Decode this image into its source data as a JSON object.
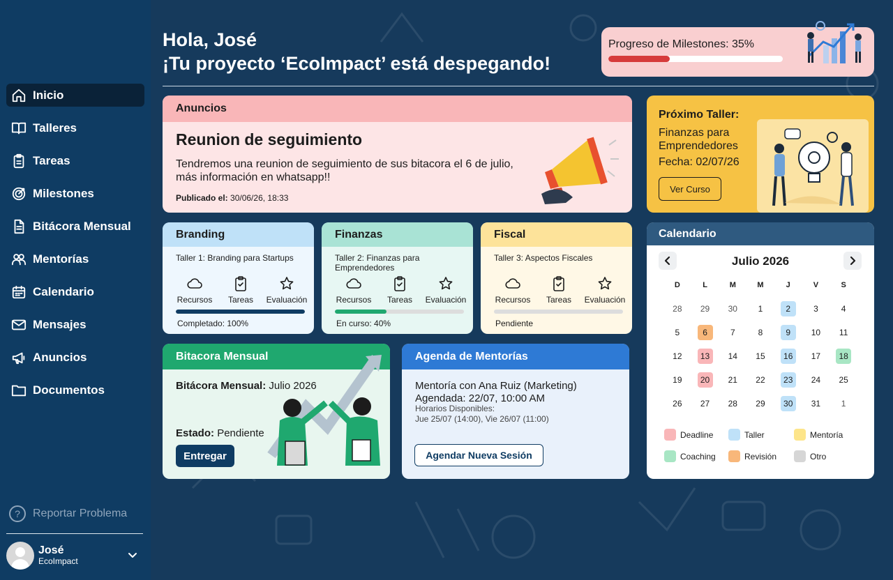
{
  "sidebar": {
    "items": [
      {
        "label": "Inicio",
        "icon": "home-icon"
      },
      {
        "label": "Talleres",
        "icon": "book-icon"
      },
      {
        "label": "Tareas",
        "icon": "clipboard-icon"
      },
      {
        "label": "Milestones",
        "icon": "target-icon"
      },
      {
        "label": "Bitácora Mensual",
        "icon": "document-icon"
      },
      {
        "label": "Mentorías",
        "icon": "people-icon"
      },
      {
        "label": "Calendario",
        "icon": "calendar-icon"
      },
      {
        "label": "Mensajes",
        "icon": "mail-icon"
      },
      {
        "label": "Anuncios",
        "icon": "megaphone-icon"
      },
      {
        "label": "Documentos",
        "icon": "folder-icon"
      }
    ],
    "report": "Reportar Problema",
    "user": {
      "name": "José",
      "org": "EcoImpact"
    }
  },
  "header": {
    "greeting": "Hola, José",
    "subtitle": "¡Tu proyecto ‘EcoImpact’ está despegando!",
    "progress_label": "Progreso de Milestones: 35%",
    "progress_value": 0.35
  },
  "announcements": {
    "header": "Anuncios",
    "title": "Reunion de seguimiento",
    "body": "Tendremos una reunion de seguimiento de sus bitacora el 6 de julio, más información en whatsapp!!",
    "published_label": "Publicado el:",
    "published_value": "30/06/26, 18:33"
  },
  "next_workshop": {
    "heading": "Próximo Taller:",
    "name": "Finanzas para Emprendedores",
    "date": "Fecha: 02/07/26",
    "button": "Ver Curso"
  },
  "workshops": [
    {
      "title": "Branding",
      "subtitle": "Taller 1:  Branding para Startups",
      "status": "Completado: 100%",
      "progress": 1.0,
      "header_color": "#bfe1f8",
      "body_color": "#eef7fe",
      "bar_color": "#0f3c63"
    },
    {
      "title": "Finanzas",
      "subtitle": "Taller 2:  Finanzas para Emprendedores",
      "status": "En curso: 40%",
      "progress": 0.4,
      "header_color": "#a9e3d5",
      "body_color": "#e7f7f3",
      "bar_color": "#1fa86f"
    },
    {
      "title": "Fiscal",
      "subtitle": "Taller 3:  Aspectos Fiscales",
      "status": "Pendiente",
      "progress": 0.0,
      "header_color": "#fde39a",
      "body_color": "#fff8e6",
      "bar_color": "#f6c244"
    }
  ],
  "workshop_actions": {
    "resources": "Recursos",
    "tasks": "Tareas",
    "evaluation": "Evaluación"
  },
  "bitacora": {
    "header": "Bitacora Mensual",
    "label1": "Bitácora Mensual:",
    "value1": "Julio 2026",
    "label2": "Estado:",
    "value2": "Pendiente",
    "button": "Entregar"
  },
  "agenda": {
    "header": "Agenda de Mentorías",
    "line1": "Mentoría con Ana Ruiz (Marketing)",
    "line2": "Agendada: 22/07, 10:00 AM",
    "line3": "Horarios Disponibles:",
    "line4": "Jue 25/07 (14:00), Vie 26/07 (11:00)",
    "button": "Agendar Nueva Sesión"
  },
  "calendar": {
    "header": "Calendario",
    "month": "Julio 2026",
    "weekdays": [
      "D",
      "L",
      "M",
      "M",
      "J",
      "V",
      "S"
    ],
    "days": [
      {
        "n": "28",
        "muted": true
      },
      {
        "n": "29",
        "muted": true
      },
      {
        "n": "30",
        "muted": true
      },
      {
        "n": "1"
      },
      {
        "n": "2",
        "tag": "Taller"
      },
      {
        "n": "3"
      },
      {
        "n": "4"
      },
      {
        "n": "5"
      },
      {
        "n": "6",
        "tag": "Revisión"
      },
      {
        "n": "7"
      },
      {
        "n": "8"
      },
      {
        "n": "9",
        "tag": "Taller"
      },
      {
        "n": "10"
      },
      {
        "n": "11"
      },
      {
        "n": "12"
      },
      {
        "n": "13",
        "tag": "Deadline"
      },
      {
        "n": "14"
      },
      {
        "n": "15"
      },
      {
        "n": "16",
        "tag": "Taller"
      },
      {
        "n": "17"
      },
      {
        "n": "18",
        "tag": "Coaching"
      },
      {
        "n": "19"
      },
      {
        "n": "20",
        "tag": "Deadline"
      },
      {
        "n": "21"
      },
      {
        "n": "22"
      },
      {
        "n": "23",
        "tag": "Taller"
      },
      {
        "n": "24"
      },
      {
        "n": "25"
      },
      {
        "n": "26"
      },
      {
        "n": "27"
      },
      {
        "n": "28"
      },
      {
        "n": "29"
      },
      {
        "n": "30",
        "tag": "Taller"
      },
      {
        "n": "31"
      },
      {
        "n": "1",
        "muted": true
      }
    ],
    "legend": [
      {
        "label": "Deadline",
        "color": "#f9b6b8"
      },
      {
        "label": "Taller",
        "color": "#bfe1f8"
      },
      {
        "label": "Mentoría",
        "color": "#fde58a"
      },
      {
        "label": "Coaching",
        "color": "#a8e6c4"
      },
      {
        "label": "Revisión",
        "color": "#f8b77a"
      },
      {
        "label": "Otro",
        "color": "#d6d6d6"
      }
    ]
  }
}
